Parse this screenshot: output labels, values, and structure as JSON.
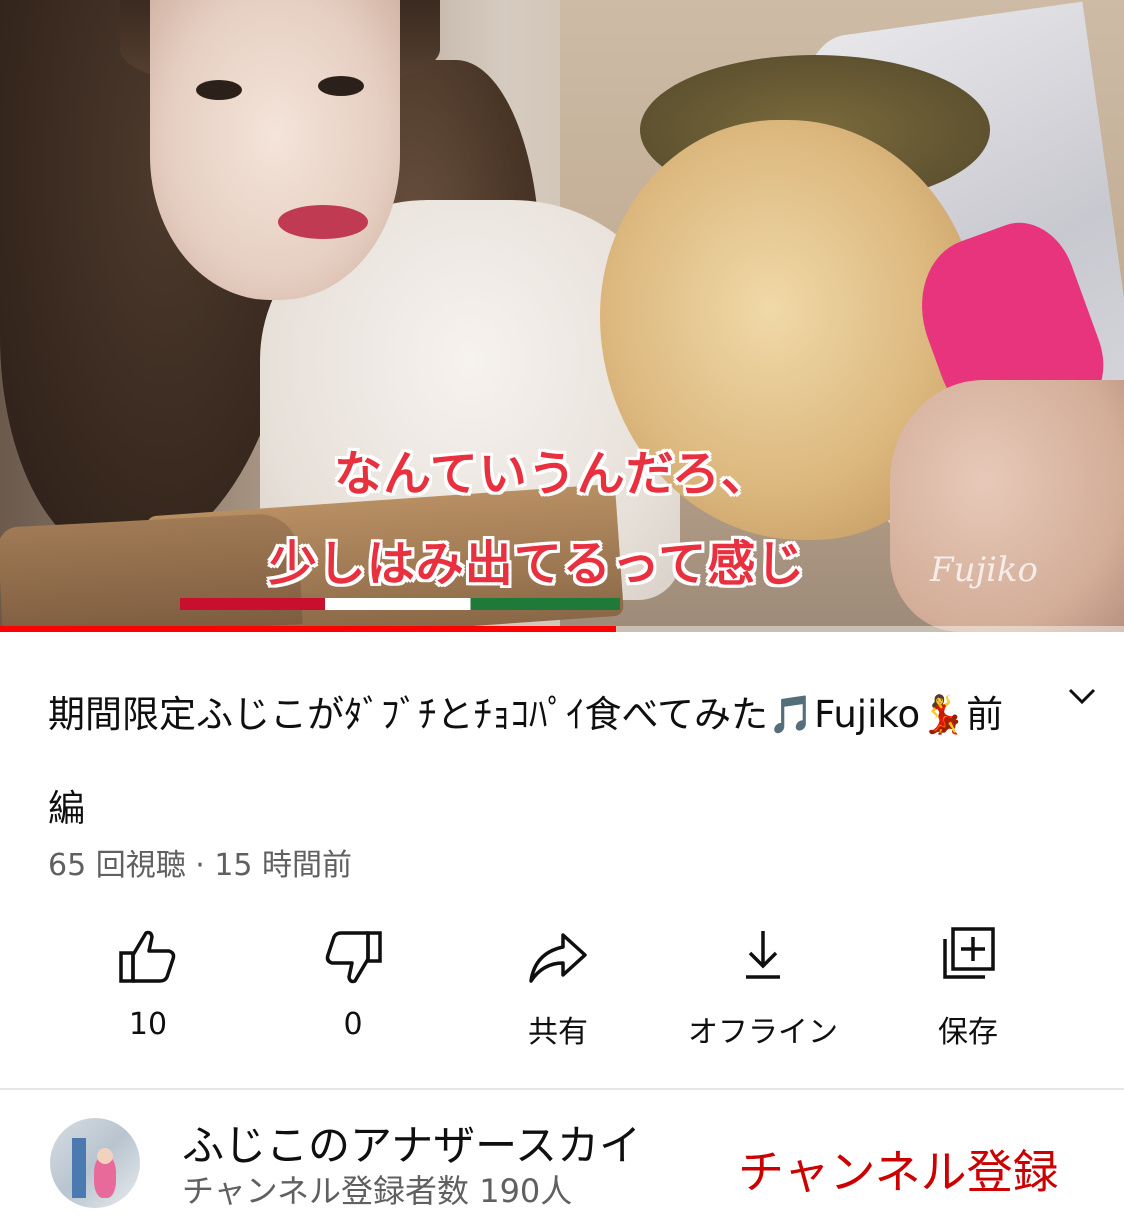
{
  "video": {
    "caption_line1": "なんていうんだろ、",
    "caption_line2": "少しはみ出てるって感じ",
    "watermark": "Fujiko",
    "progress": 0.548,
    "colors": {
      "progress": "#ff0000",
      "caption": "#e8303e"
    }
  },
  "info": {
    "title": "期間限定ふじこがﾀﾞﾌﾞﾁとﾁｮｺﾊﾟｲ食べてみた🎵Fujiko💃前編",
    "meta": "65 回視聴 · 15 時間前",
    "expand_icon": "chevron-down-icon"
  },
  "actions": [
    {
      "icon": "thumbs-up-icon",
      "label": "10"
    },
    {
      "icon": "thumbs-down-icon",
      "label": "0"
    },
    {
      "icon": "share-icon",
      "label": "共有"
    },
    {
      "icon": "download-icon",
      "label": "オフライン"
    },
    {
      "icon": "save-playlist-icon",
      "label": "保存"
    }
  ],
  "channel": {
    "name": "ふじこのアナザースカイ",
    "subscribers": "チャンネル登録者数 190人",
    "subscribe_label": "チャンネル登録",
    "colors": {
      "subscribe": "#cc0000"
    }
  }
}
